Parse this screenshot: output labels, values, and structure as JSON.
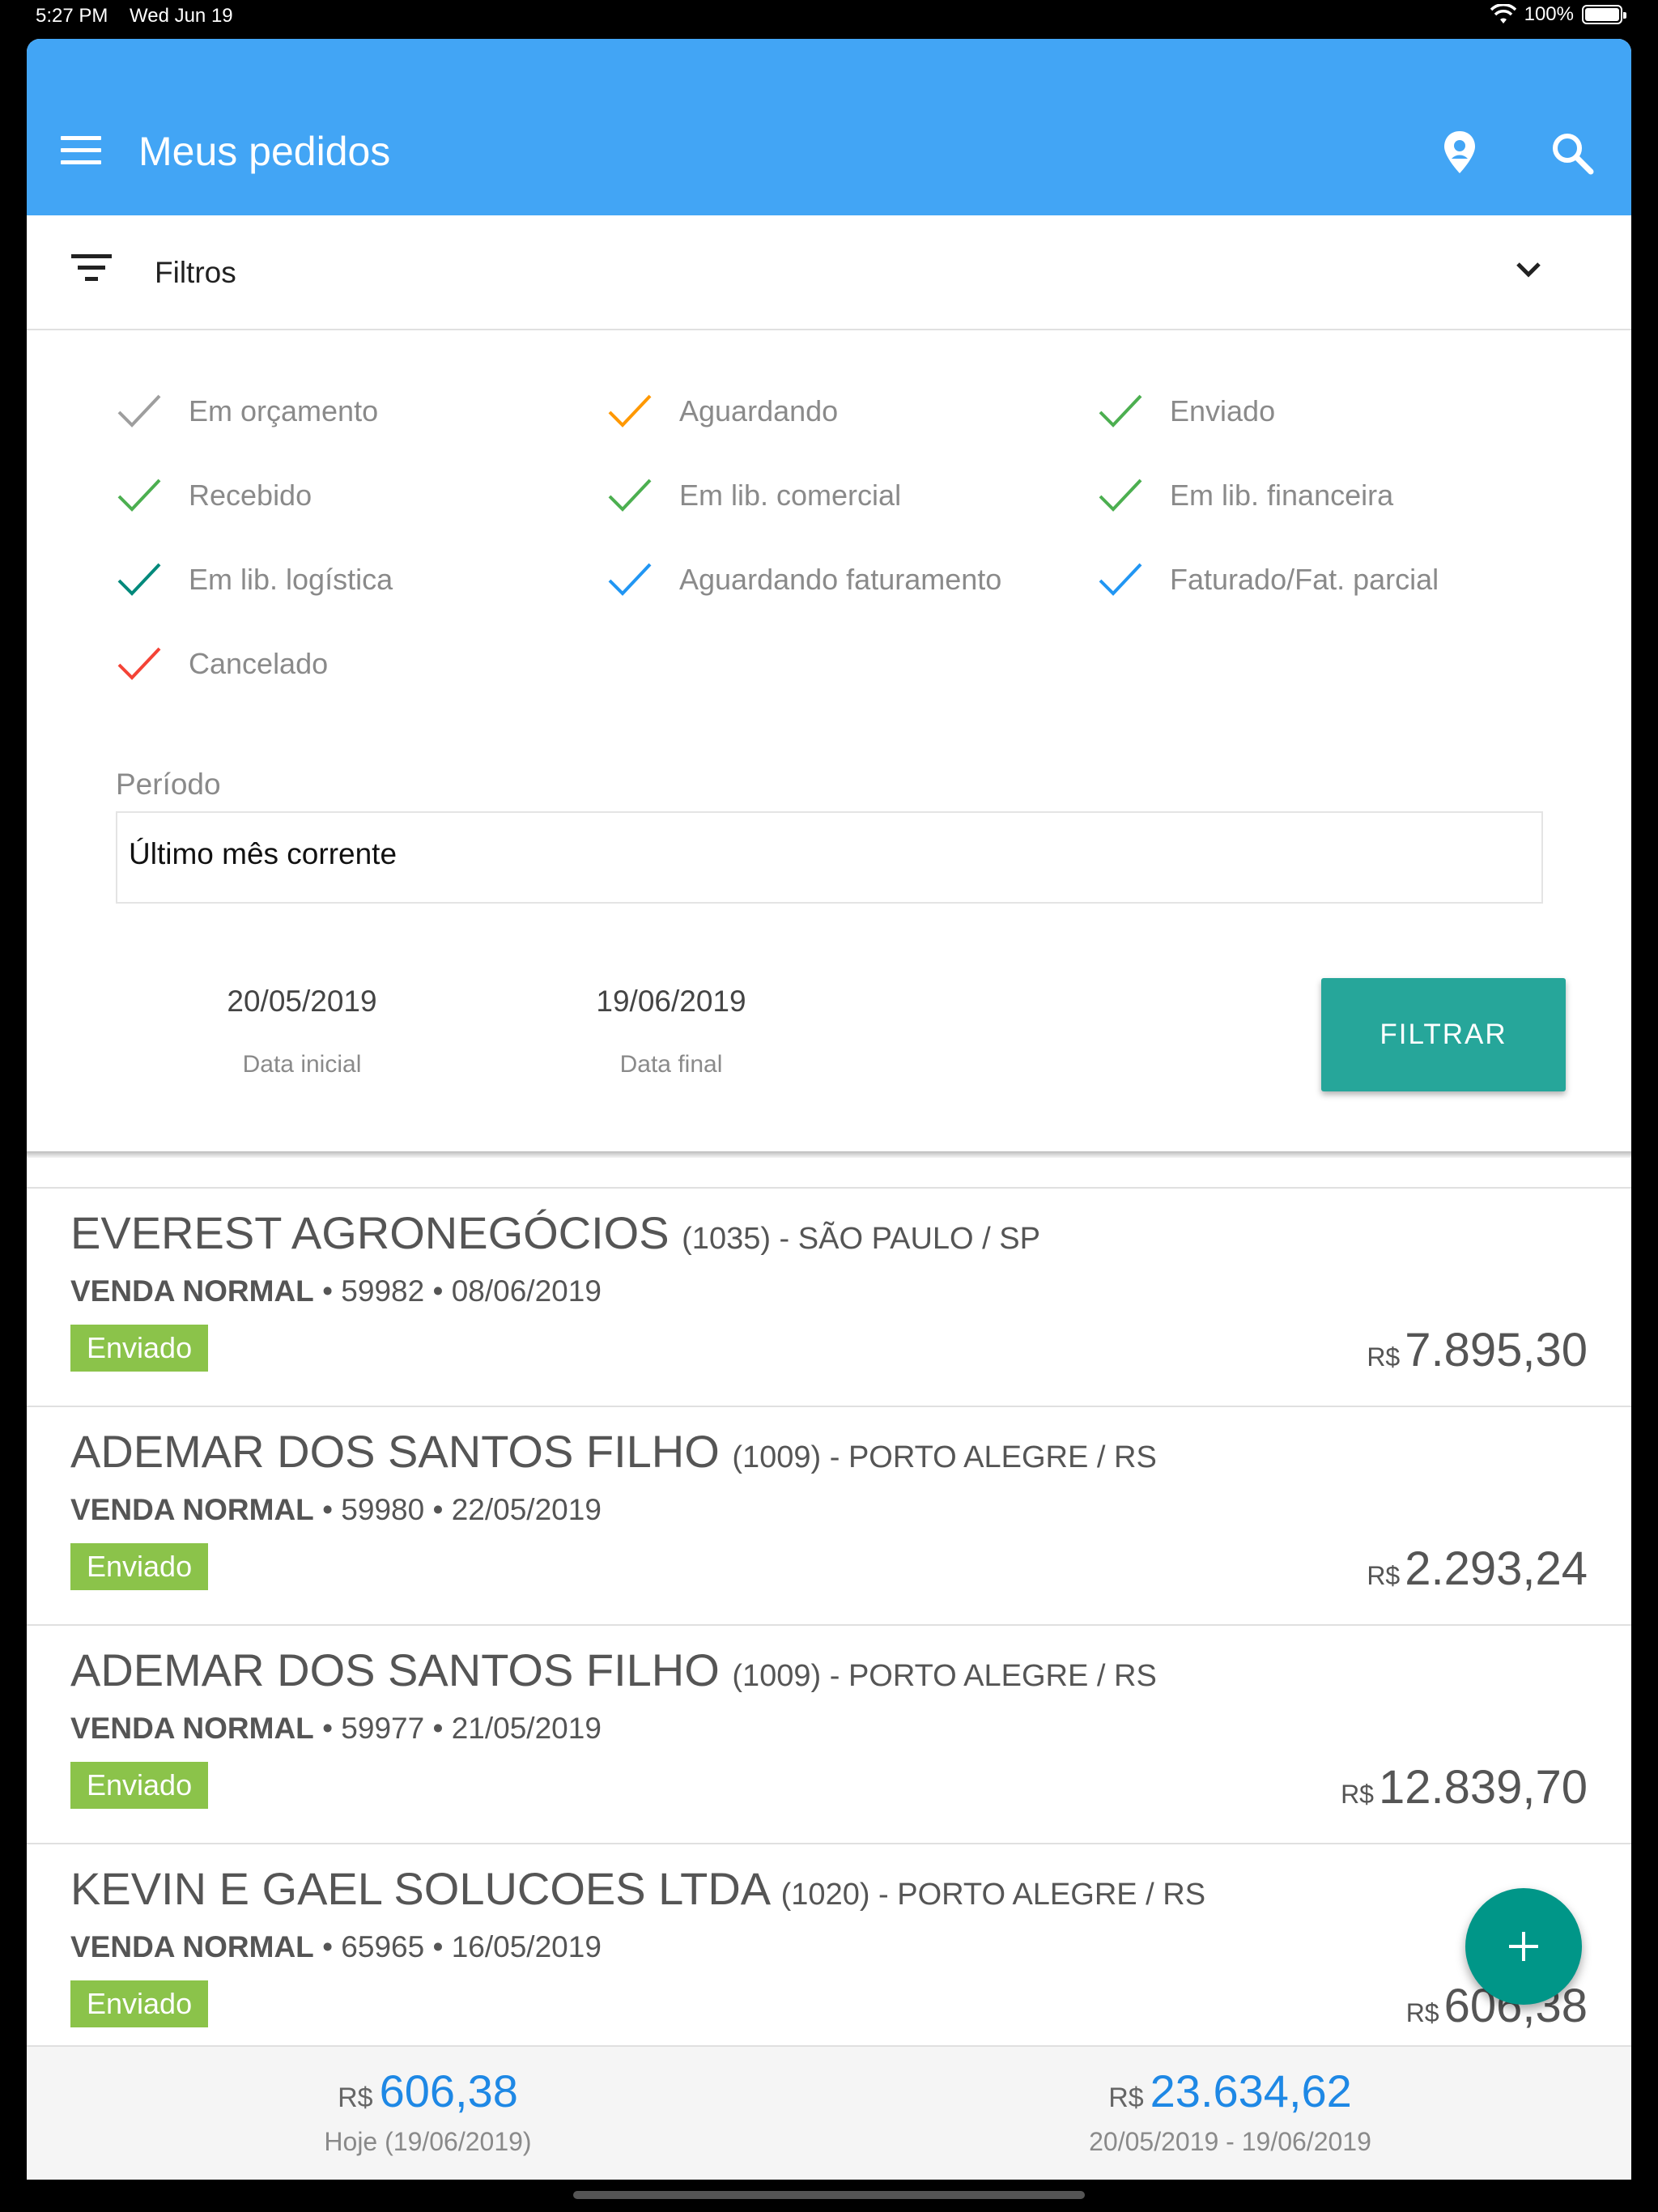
{
  "statusbar": {
    "time": "5:27 PM",
    "date": "Wed Jun 19",
    "battery": "100%"
  },
  "appbar": {
    "title": "Meus pedidos"
  },
  "filters": {
    "label": "Filtros",
    "statuses": [
      {
        "label": "Em orçamento",
        "color": "#9e9e9e"
      },
      {
        "label": "Aguardando",
        "color": "#ff9800"
      },
      {
        "label": "Enviado",
        "color": "#4caf50"
      },
      {
        "label": "Recebido",
        "color": "#4caf50"
      },
      {
        "label": "Em lib. comercial",
        "color": "#4caf50"
      },
      {
        "label": "Em lib. financeira",
        "color": "#4caf50"
      },
      {
        "label": "Em lib. logística",
        "color": "#00897b"
      },
      {
        "label": "Aguardando faturamento",
        "color": "#2196f3"
      },
      {
        "label": "Faturado/Fat. parcial",
        "color": "#2196f3"
      },
      {
        "label": "Cancelado",
        "color": "#f44336"
      }
    ],
    "periodo_label": "Período",
    "periodo_value": "Último mês corrente",
    "data_inicial": {
      "value": "20/05/2019",
      "caption": "Data inicial"
    },
    "data_final": {
      "value": "19/06/2019",
      "caption": "Data final"
    },
    "button": "FILTRAR"
  },
  "orders": [
    {
      "name": "EVEREST AGRONEGÓCIOS",
      "extra": "(1035) - SÃO PAULO / SP",
      "type": "VENDA NORMAL",
      "rest": " • 59982 • 08/06/2019",
      "status": "Enviado",
      "currency": "R$",
      "amount": "7.895,30"
    },
    {
      "name": "ADEMAR DOS SANTOS FILHO",
      "extra": "(1009) - PORTO ALEGRE / RS",
      "type": "VENDA NORMAL",
      "rest": " • 59980 • 22/05/2019",
      "status": "Enviado",
      "currency": "R$",
      "amount": "2.293,24"
    },
    {
      "name": "ADEMAR DOS SANTOS FILHO",
      "extra": "(1009) - PORTO ALEGRE / RS",
      "type": "VENDA NORMAL",
      "rest": " • 59977 • 21/05/2019",
      "status": "Enviado",
      "currency": "R$",
      "amount": "12.839,70"
    },
    {
      "name": "KEVIN E GAEL SOLUCOES LTDA",
      "extra": "(1020) - PORTO ALEGRE / RS",
      "type": "VENDA NORMAL",
      "rest": " • 65965 • 16/05/2019",
      "status": "Enviado",
      "currency": "R$",
      "amount": "606,38"
    }
  ],
  "totals": {
    "today": {
      "currency": "R$",
      "amount": "606,38",
      "caption": "Hoje (19/06/2019)"
    },
    "period": {
      "currency": "R$",
      "amount": "23.634,62",
      "caption": "20/05/2019 - 19/06/2019"
    }
  },
  "colors": {
    "appbar": "#42a5f5",
    "accent": "#26a69a",
    "badge": "#8bc34a",
    "fab": "#009688"
  }
}
